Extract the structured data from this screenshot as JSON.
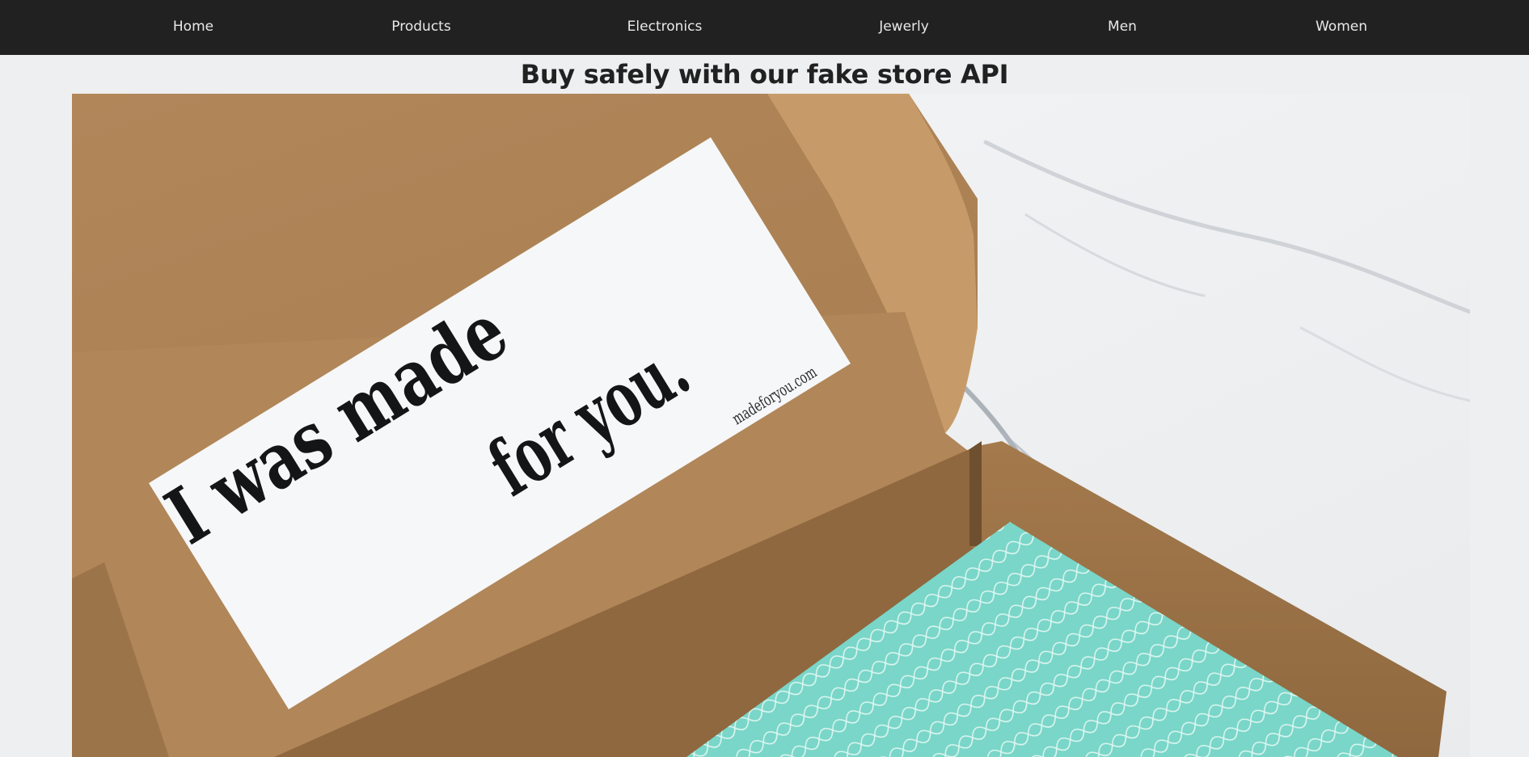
{
  "nav": {
    "items": [
      {
        "label": "Home",
        "name": "nav-home"
      },
      {
        "label": "Products",
        "name": "nav-products"
      },
      {
        "label": "Electronics",
        "name": "nav-electronics"
      },
      {
        "label": "Jewerly",
        "name": "nav-jewerly"
      },
      {
        "label": "Men",
        "name": "nav-men"
      },
      {
        "label": "Women",
        "name": "nav-women"
      }
    ]
  },
  "hero": {
    "headline": "Buy safely with our fake store API",
    "card": {
      "line1": "I was made",
      "line2": "for you.",
      "website": "madeforyou.com"
    }
  },
  "colors": {
    "navbar_bg": "#212121",
    "nav_text": "#e9e9e9",
    "page_bg": "#eeeff0",
    "headline_text": "#212121",
    "cardboard": "#b88d5d",
    "tissue": "#79d6c8"
  }
}
